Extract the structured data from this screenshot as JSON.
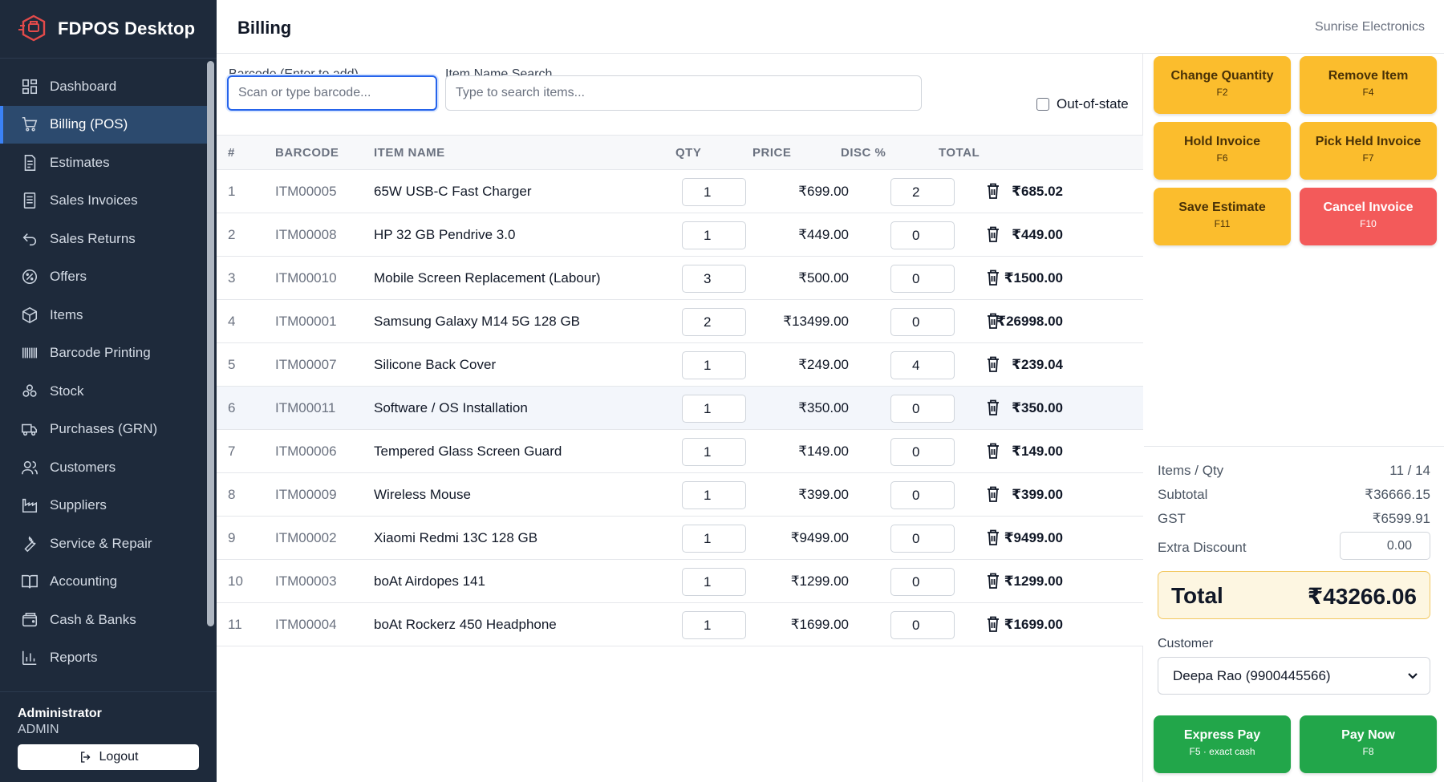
{
  "app": {
    "title": "FDPOS Desktop"
  },
  "sidebar": {
    "items": [
      {
        "label": "Dashboard",
        "icon": "dashboard-icon"
      },
      {
        "label": "Billing (POS)",
        "icon": "cart-icon",
        "active": true
      },
      {
        "label": "Estimates",
        "icon": "document-icon"
      },
      {
        "label": "Sales Invoices",
        "icon": "invoice-icon"
      },
      {
        "label": "Sales Returns",
        "icon": "return-icon"
      },
      {
        "label": "Offers",
        "icon": "offer-icon"
      },
      {
        "label": "Items",
        "icon": "box-icon"
      },
      {
        "label": "Barcode Printing",
        "icon": "barcode-icon"
      },
      {
        "label": "Stock",
        "icon": "stock-icon"
      },
      {
        "label": "Purchases (GRN)",
        "icon": "truck-icon"
      },
      {
        "label": "Customers",
        "icon": "users-icon"
      },
      {
        "label": "Suppliers",
        "icon": "factory-icon"
      },
      {
        "label": "Service & Repair",
        "icon": "wrench-icon"
      },
      {
        "label": "Accounting",
        "icon": "book-icon"
      },
      {
        "label": "Cash & Banks",
        "icon": "wallet-icon"
      },
      {
        "label": "Reports",
        "icon": "chart-icon"
      }
    ],
    "user": {
      "name": "Administrator",
      "role": "ADMIN"
    },
    "logout_label": "Logout"
  },
  "header": {
    "title": "Billing",
    "company": "Sunrise Electronics"
  },
  "search": {
    "barcode_label": "Barcode (Enter to add)",
    "barcode_placeholder": "Scan or type barcode...",
    "name_label": "Item Name Search",
    "name_placeholder": "Type to search items...",
    "out_of_state_label": "Out-of-state"
  },
  "table": {
    "headers": {
      "idx": "#",
      "barcode": "BARCODE",
      "name": "ITEM NAME",
      "qty": "QTY",
      "price": "PRICE",
      "disc": "DISC %",
      "total": "TOTAL"
    },
    "rows": [
      {
        "idx": "1",
        "barcode": "ITM00005",
        "name": "65W USB-C Fast Charger",
        "qty": "1",
        "price": "₹699.00",
        "disc": "2",
        "total": "₹685.02"
      },
      {
        "idx": "2",
        "barcode": "ITM00008",
        "name": "HP 32 GB Pendrive 3.0",
        "qty": "1",
        "price": "₹449.00",
        "disc": "0",
        "total": "₹449.00"
      },
      {
        "idx": "3",
        "barcode": "ITM00010",
        "name": "Mobile Screen Replacement (Labour)",
        "qty": "3",
        "price": "₹500.00",
        "disc": "0",
        "total": "₹1500.00"
      },
      {
        "idx": "4",
        "barcode": "ITM00001",
        "name": "Samsung Galaxy M14 5G 128 GB",
        "qty": "2",
        "price": "₹13499.00",
        "disc": "0",
        "total": "₹26998.00"
      },
      {
        "idx": "5",
        "barcode": "ITM00007",
        "name": "Silicone Back Cover",
        "qty": "1",
        "price": "₹249.00",
        "disc": "4",
        "total": "₹239.04"
      },
      {
        "idx": "6",
        "barcode": "ITM00011",
        "name": "Software / OS Installation",
        "qty": "1",
        "price": "₹350.00",
        "disc": "0",
        "total": "₹350.00"
      },
      {
        "idx": "7",
        "barcode": "ITM00006",
        "name": "Tempered Glass Screen Guard",
        "qty": "1",
        "price": "₹149.00",
        "disc": "0",
        "total": "₹149.00"
      },
      {
        "idx": "8",
        "barcode": "ITM00009",
        "name": "Wireless Mouse",
        "qty": "1",
        "price": "₹399.00",
        "disc": "0",
        "total": "₹399.00"
      },
      {
        "idx": "9",
        "barcode": "ITM00002",
        "name": "Xiaomi Redmi 13C 128 GB",
        "qty": "1",
        "price": "₹9499.00",
        "disc": "0",
        "total": "₹9499.00"
      },
      {
        "idx": "10",
        "barcode": "ITM00003",
        "name": "boAt Airdopes 141",
        "qty": "1",
        "price": "₹1299.00",
        "disc": "0",
        "total": "₹1299.00"
      },
      {
        "idx": "11",
        "barcode": "ITM00004",
        "name": "boAt Rockerz 450 Headphone",
        "qty": "1",
        "price": "₹1699.00",
        "disc": "0",
        "total": "₹1699.00"
      }
    ]
  },
  "actions": {
    "change_qty": {
      "label": "Change Quantity",
      "key": "F2"
    },
    "remove_item": {
      "label": "Remove Item",
      "key": "F4"
    },
    "hold_invoice": {
      "label": "Hold Invoice",
      "key": "F6"
    },
    "pick_held": {
      "label": "Pick Held Invoice",
      "key": "F7"
    },
    "save_estimate": {
      "label": "Save Estimate",
      "key": "F11"
    },
    "cancel_invoice": {
      "label": "Cancel Invoice",
      "key": "F10"
    },
    "express_pay": {
      "label": "Express Pay",
      "key": "F5 · exact cash"
    },
    "pay_now": {
      "label": "Pay Now",
      "key": "F8"
    }
  },
  "summary": {
    "items_label": "Items / Qty",
    "items_value": "11 / 14",
    "subtotal_label": "Subtotal",
    "subtotal_value": "₹36666.15",
    "gst_label": "GST",
    "gst_value": "₹6599.91",
    "extra_discount_label": "Extra Discount",
    "extra_discount_value": "0.00",
    "total_label": "Total",
    "total_value": "₹43266.06"
  },
  "customer": {
    "label": "Customer",
    "selected": "Deepa Rao (9900445566)"
  },
  "colors": {
    "sidebar": "#1e2a3b",
    "active": "#2c4a6e",
    "amber": "#fbbd2d",
    "red": "#f35a5a",
    "green": "#22a64a"
  }
}
